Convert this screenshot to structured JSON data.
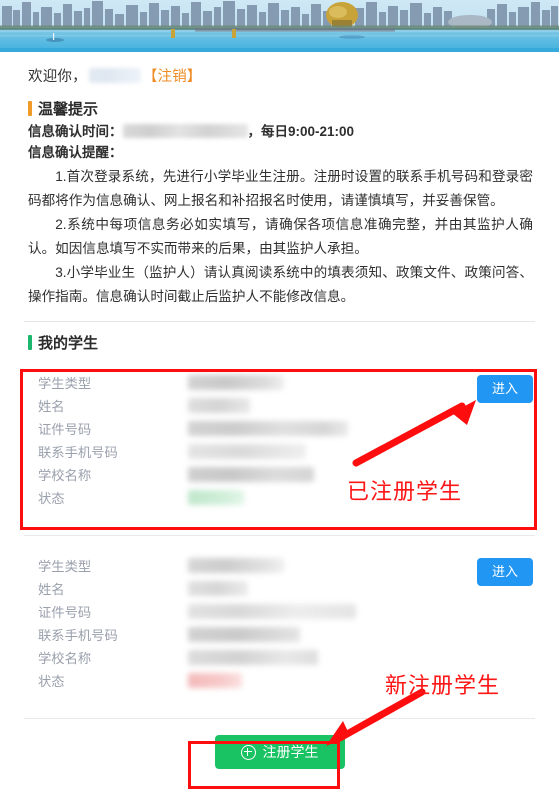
{
  "banner": {
    "alt": "hangzhou-skyline-banner",
    "sky_color": "#bfe3f2",
    "water_color": "#49b6e0"
  },
  "welcome": {
    "prefix": "欢迎你，",
    "name_redacted": "",
    "logout_label": "【注销】"
  },
  "tips_section": {
    "title": "温馨提示",
    "accent_color": "#f09b28",
    "confirm_time_label": "信息确认时间：",
    "confirm_time_value_redacted": "",
    "confirm_time_suffix": "，每日9:00-21:00",
    "reminder_label": "信息确认提醒：",
    "paragraphs": [
      "1.首次登录系统，先进行小学毕业生注册。注册时设置的联系手机号码和登录密码都将作为信息确认、网上报名和补招报名时使用，请谨慎填写，并妥善保管。",
      "2.系统中每项信息务必如实填写，请确保各项信息准确完整，并由其监护人确认。如因信息填写不实而带来的后果，由其监护人承担。",
      "3.小学毕业生（监护人）请认真阅读系统中的填表须知、政策文件、政策问答、操作指南。信息确认时间截止后监护人不能修改信息。"
    ]
  },
  "students_section": {
    "title": "我的学生",
    "accent_color": "#1bb76e",
    "field_labels": [
      "学生类型",
      "姓名",
      "证件号码",
      "联系手机号码",
      "学校名称",
      "状态"
    ],
    "enter_button_label": "进入",
    "enter_button_color": "#2196f3",
    "cards": [
      {
        "id": "registered-student",
        "values_redacted": true
      },
      {
        "id": "new-student",
        "values_redacted": true
      }
    ]
  },
  "register_button": {
    "label": "注册学生",
    "icon": "plus-circle-icon",
    "color": "#19c263"
  },
  "annotations": {
    "color": "#fd0d0d",
    "items": [
      {
        "name": "registered-student-annotation",
        "text": "已注册学生"
      },
      {
        "name": "new-student-annotation",
        "text": "新注册学生"
      }
    ]
  }
}
